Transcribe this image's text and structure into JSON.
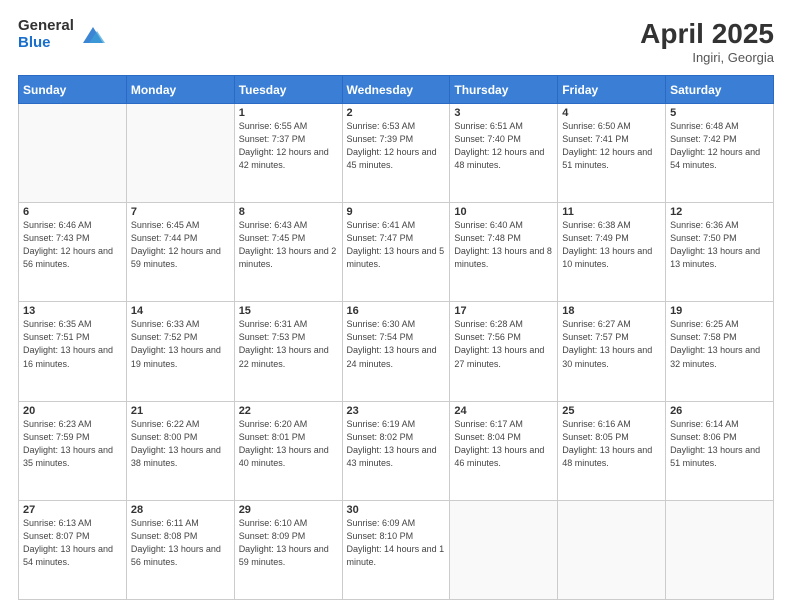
{
  "header": {
    "logo_general": "General",
    "logo_blue": "Blue",
    "title": "April 2025",
    "location": "Ingiri, Georgia"
  },
  "weekdays": [
    "Sunday",
    "Monday",
    "Tuesday",
    "Wednesday",
    "Thursday",
    "Friday",
    "Saturday"
  ],
  "weeks": [
    [
      {
        "day": "",
        "sunrise": "",
        "sunset": "",
        "daylight": ""
      },
      {
        "day": "",
        "sunrise": "",
        "sunset": "",
        "daylight": ""
      },
      {
        "day": "1",
        "sunrise": "Sunrise: 6:55 AM",
        "sunset": "Sunset: 7:37 PM",
        "daylight": "Daylight: 12 hours and 42 minutes."
      },
      {
        "day": "2",
        "sunrise": "Sunrise: 6:53 AM",
        "sunset": "Sunset: 7:39 PM",
        "daylight": "Daylight: 12 hours and 45 minutes."
      },
      {
        "day": "3",
        "sunrise": "Sunrise: 6:51 AM",
        "sunset": "Sunset: 7:40 PM",
        "daylight": "Daylight: 12 hours and 48 minutes."
      },
      {
        "day": "4",
        "sunrise": "Sunrise: 6:50 AM",
        "sunset": "Sunset: 7:41 PM",
        "daylight": "Daylight: 12 hours and 51 minutes."
      },
      {
        "day": "5",
        "sunrise": "Sunrise: 6:48 AM",
        "sunset": "Sunset: 7:42 PM",
        "daylight": "Daylight: 12 hours and 54 minutes."
      }
    ],
    [
      {
        "day": "6",
        "sunrise": "Sunrise: 6:46 AM",
        "sunset": "Sunset: 7:43 PM",
        "daylight": "Daylight: 12 hours and 56 minutes."
      },
      {
        "day": "7",
        "sunrise": "Sunrise: 6:45 AM",
        "sunset": "Sunset: 7:44 PM",
        "daylight": "Daylight: 12 hours and 59 minutes."
      },
      {
        "day": "8",
        "sunrise": "Sunrise: 6:43 AM",
        "sunset": "Sunset: 7:45 PM",
        "daylight": "Daylight: 13 hours and 2 minutes."
      },
      {
        "day": "9",
        "sunrise": "Sunrise: 6:41 AM",
        "sunset": "Sunset: 7:47 PM",
        "daylight": "Daylight: 13 hours and 5 minutes."
      },
      {
        "day": "10",
        "sunrise": "Sunrise: 6:40 AM",
        "sunset": "Sunset: 7:48 PM",
        "daylight": "Daylight: 13 hours and 8 minutes."
      },
      {
        "day": "11",
        "sunrise": "Sunrise: 6:38 AM",
        "sunset": "Sunset: 7:49 PM",
        "daylight": "Daylight: 13 hours and 10 minutes."
      },
      {
        "day": "12",
        "sunrise": "Sunrise: 6:36 AM",
        "sunset": "Sunset: 7:50 PM",
        "daylight": "Daylight: 13 hours and 13 minutes."
      }
    ],
    [
      {
        "day": "13",
        "sunrise": "Sunrise: 6:35 AM",
        "sunset": "Sunset: 7:51 PM",
        "daylight": "Daylight: 13 hours and 16 minutes."
      },
      {
        "day": "14",
        "sunrise": "Sunrise: 6:33 AM",
        "sunset": "Sunset: 7:52 PM",
        "daylight": "Daylight: 13 hours and 19 minutes."
      },
      {
        "day": "15",
        "sunrise": "Sunrise: 6:31 AM",
        "sunset": "Sunset: 7:53 PM",
        "daylight": "Daylight: 13 hours and 22 minutes."
      },
      {
        "day": "16",
        "sunrise": "Sunrise: 6:30 AM",
        "sunset": "Sunset: 7:54 PM",
        "daylight": "Daylight: 13 hours and 24 minutes."
      },
      {
        "day": "17",
        "sunrise": "Sunrise: 6:28 AM",
        "sunset": "Sunset: 7:56 PM",
        "daylight": "Daylight: 13 hours and 27 minutes."
      },
      {
        "day": "18",
        "sunrise": "Sunrise: 6:27 AM",
        "sunset": "Sunset: 7:57 PM",
        "daylight": "Daylight: 13 hours and 30 minutes."
      },
      {
        "day": "19",
        "sunrise": "Sunrise: 6:25 AM",
        "sunset": "Sunset: 7:58 PM",
        "daylight": "Daylight: 13 hours and 32 minutes."
      }
    ],
    [
      {
        "day": "20",
        "sunrise": "Sunrise: 6:23 AM",
        "sunset": "Sunset: 7:59 PM",
        "daylight": "Daylight: 13 hours and 35 minutes."
      },
      {
        "day": "21",
        "sunrise": "Sunrise: 6:22 AM",
        "sunset": "Sunset: 8:00 PM",
        "daylight": "Daylight: 13 hours and 38 minutes."
      },
      {
        "day": "22",
        "sunrise": "Sunrise: 6:20 AM",
        "sunset": "Sunset: 8:01 PM",
        "daylight": "Daylight: 13 hours and 40 minutes."
      },
      {
        "day": "23",
        "sunrise": "Sunrise: 6:19 AM",
        "sunset": "Sunset: 8:02 PM",
        "daylight": "Daylight: 13 hours and 43 minutes."
      },
      {
        "day": "24",
        "sunrise": "Sunrise: 6:17 AM",
        "sunset": "Sunset: 8:04 PM",
        "daylight": "Daylight: 13 hours and 46 minutes."
      },
      {
        "day": "25",
        "sunrise": "Sunrise: 6:16 AM",
        "sunset": "Sunset: 8:05 PM",
        "daylight": "Daylight: 13 hours and 48 minutes."
      },
      {
        "day": "26",
        "sunrise": "Sunrise: 6:14 AM",
        "sunset": "Sunset: 8:06 PM",
        "daylight": "Daylight: 13 hours and 51 minutes."
      }
    ],
    [
      {
        "day": "27",
        "sunrise": "Sunrise: 6:13 AM",
        "sunset": "Sunset: 8:07 PM",
        "daylight": "Daylight: 13 hours and 54 minutes."
      },
      {
        "day": "28",
        "sunrise": "Sunrise: 6:11 AM",
        "sunset": "Sunset: 8:08 PM",
        "daylight": "Daylight: 13 hours and 56 minutes."
      },
      {
        "day": "29",
        "sunrise": "Sunrise: 6:10 AM",
        "sunset": "Sunset: 8:09 PM",
        "daylight": "Daylight: 13 hours and 59 minutes."
      },
      {
        "day": "30",
        "sunrise": "Sunrise: 6:09 AM",
        "sunset": "Sunset: 8:10 PM",
        "daylight": "Daylight: 14 hours and 1 minute."
      },
      {
        "day": "",
        "sunrise": "",
        "sunset": "",
        "daylight": ""
      },
      {
        "day": "",
        "sunrise": "",
        "sunset": "",
        "daylight": ""
      },
      {
        "day": "",
        "sunrise": "",
        "sunset": "",
        "daylight": ""
      }
    ]
  ]
}
